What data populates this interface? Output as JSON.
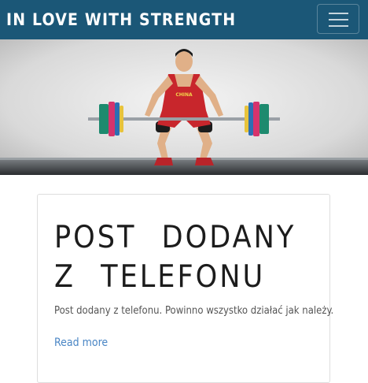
{
  "navbar": {
    "brand": "IN LOVE WITH STRENGTH",
    "background": "#1b5777",
    "menu_icon": "hamburger-menu-icon"
  },
  "hero": {
    "jersey_text": "CHINA"
  },
  "post": {
    "title": "POST DODANY Z TELEFONU",
    "excerpt": "Post dodany z telefonu. Powinno wszystko działać jak należy.",
    "read_more": "Read more",
    "link_color": "#4a86c5"
  }
}
